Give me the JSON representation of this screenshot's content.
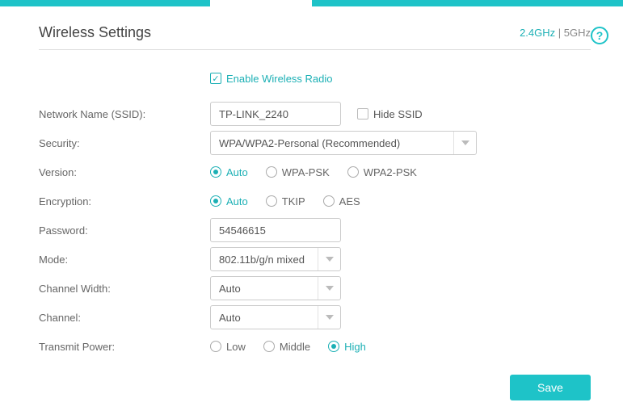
{
  "header": {
    "title": "Wireless Settings",
    "band_24": "2.4GHz",
    "band_5": "5GHz",
    "separator": " | "
  },
  "enable": {
    "label": "Enable Wireless Radio",
    "checked": true
  },
  "labels": {
    "ssid": "Network Name (SSID):",
    "security": "Security:",
    "version": "Version:",
    "encryption": "Encryption:",
    "password": "Password:",
    "mode": "Mode:",
    "channel_width": "Channel Width:",
    "channel": "Channel:",
    "transmit_power": "Transmit Power:"
  },
  "ssid": {
    "value": "TP-LINK_2240",
    "hide_label": "Hide SSID",
    "hide_checked": false
  },
  "security": {
    "selected": "WPA/WPA2-Personal (Recommended)"
  },
  "version": {
    "options": [
      "Auto",
      "WPA-PSK",
      "WPA2-PSK"
    ],
    "selected": "Auto"
  },
  "encryption": {
    "options": [
      "Auto",
      "TKIP",
      "AES"
    ],
    "selected": "Auto"
  },
  "password": {
    "value": "54546615"
  },
  "mode": {
    "selected": "802.11b/g/n mixed"
  },
  "channel_width": {
    "selected": "Auto"
  },
  "channel": {
    "selected": "Auto"
  },
  "transmit_power": {
    "options": [
      "Low",
      "Middle",
      "High"
    ],
    "selected": "High"
  },
  "buttons": {
    "save": "Save"
  }
}
